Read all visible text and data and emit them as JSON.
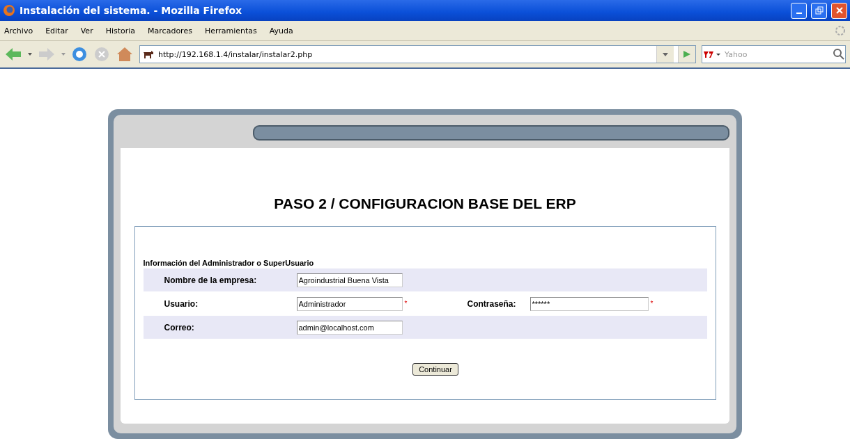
{
  "window": {
    "title": "Instalación del sistema. - Mozilla Firefox"
  },
  "menu": [
    "Archivo",
    "Editar",
    "Ver",
    "Historia",
    "Marcadores",
    "Herramientas",
    "Ayuda"
  ],
  "address": {
    "value": "http://192.168.1.4/instalar/instalar2.php"
  },
  "search": {
    "placeholder": "Yahoo"
  },
  "page": {
    "heading": "PASO 2 / CONFIGURACION BASE DEL ERP",
    "section_title": "Información del Administrador o SuperUsuario",
    "rows": [
      {
        "shaded": true,
        "fields": [
          {
            "label": "Nombre de la empresa:",
            "value": "Agroindustrial Buena Vista"
          }
        ]
      },
      {
        "shaded": false,
        "fields": [
          {
            "label": "Usuario:",
            "value": "Administrador",
            "required_mark": "*"
          },
          {
            "label": "Contraseña:",
            "value": "******",
            "required_mark": "*"
          }
        ]
      },
      {
        "shaded": true,
        "fields": [
          {
            "label": "Correo:",
            "value": "admin@localhost.com"
          }
        ]
      }
    ],
    "button": "Continuar"
  }
}
